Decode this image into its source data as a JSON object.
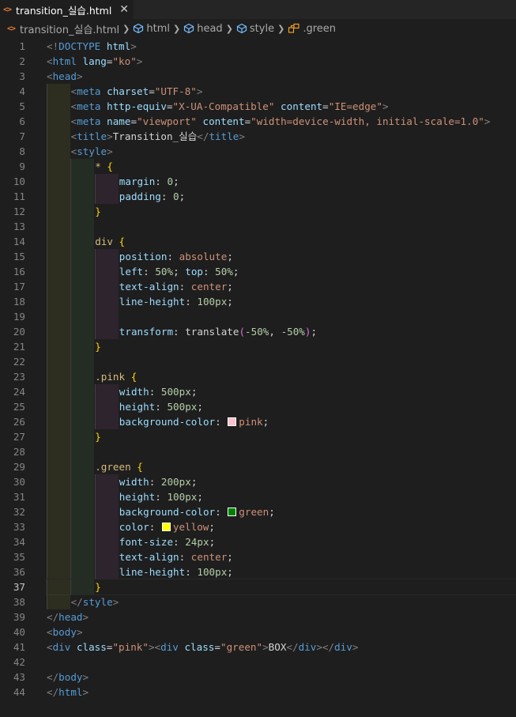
{
  "tab": {
    "title": "transition_실습.html",
    "icon": "html-file-icon",
    "close": "✕"
  },
  "breadcrumb": {
    "file": "transition_실습.html",
    "items": [
      "html",
      "head",
      "style",
      ".green"
    ]
  },
  "colors": {
    "pink": "#ffc0cb",
    "green": "#008000",
    "yellow": "#ffff00"
  },
  "lines": [
    {
      "n": "1",
      "indent": 0,
      "tokens": [
        [
          "bracket",
          "<!"
        ],
        [
          "tag",
          "DOCTYPE"
        ],
        [
          "text",
          " "
        ],
        [
          "attr",
          "html"
        ],
        [
          "bracket",
          ">"
        ]
      ]
    },
    {
      "n": "2",
      "indent": 0,
      "tokens": [
        [
          "bracket",
          "<"
        ],
        [
          "tag",
          "html"
        ],
        [
          "text",
          " "
        ],
        [
          "attr",
          "lang"
        ],
        [
          "text",
          "="
        ],
        [
          "str",
          "\"ko\""
        ],
        [
          "bracket",
          ">"
        ]
      ]
    },
    {
      "n": "3",
      "indent": 0,
      "tokens": [
        [
          "bracket",
          "<"
        ],
        [
          "tag",
          "head"
        ],
        [
          "bracket",
          ">"
        ]
      ]
    },
    {
      "n": "4",
      "indent": 1,
      "tokens": [
        [
          "bracket",
          "<"
        ],
        [
          "tag",
          "meta"
        ],
        [
          "text",
          " "
        ],
        [
          "attr",
          "charset"
        ],
        [
          "text",
          "="
        ],
        [
          "str",
          "\"UTF-8\""
        ],
        [
          "bracket",
          ">"
        ]
      ]
    },
    {
      "n": "5",
      "indent": 1,
      "tokens": [
        [
          "bracket",
          "<"
        ],
        [
          "tag",
          "meta"
        ],
        [
          "text",
          " "
        ],
        [
          "attr",
          "http-equiv"
        ],
        [
          "text",
          "="
        ],
        [
          "str",
          "\"X-UA-Compatible\""
        ],
        [
          "text",
          " "
        ],
        [
          "attr",
          "content"
        ],
        [
          "text",
          "="
        ],
        [
          "str",
          "\"IE=edge\""
        ],
        [
          "bracket",
          ">"
        ]
      ]
    },
    {
      "n": "6",
      "indent": 1,
      "tokens": [
        [
          "bracket",
          "<"
        ],
        [
          "tag",
          "meta"
        ],
        [
          "text",
          " "
        ],
        [
          "attr",
          "name"
        ],
        [
          "text",
          "="
        ],
        [
          "str",
          "\"viewport\""
        ],
        [
          "text",
          " "
        ],
        [
          "attr",
          "content"
        ],
        [
          "text",
          "="
        ],
        [
          "str",
          "\"width=device-width, initial-scale=1.0\""
        ],
        [
          "bracket",
          ">"
        ]
      ]
    },
    {
      "n": "7",
      "indent": 1,
      "tokens": [
        [
          "bracket",
          "<"
        ],
        [
          "tag",
          "title"
        ],
        [
          "bracket",
          ">"
        ],
        [
          "text",
          "Transition_실습"
        ],
        [
          "bracket",
          "</"
        ],
        [
          "tag",
          "title"
        ],
        [
          "bracket",
          ">"
        ]
      ]
    },
    {
      "n": "8",
      "indent": 1,
      "tokens": [
        [
          "bracket",
          "<"
        ],
        [
          "tag",
          "style"
        ],
        [
          "bracket",
          ">"
        ]
      ]
    },
    {
      "n": "9",
      "indent": 2,
      "tokens": [
        [
          "sel",
          "*"
        ],
        [
          "text",
          " "
        ],
        [
          "brace",
          "{"
        ]
      ]
    },
    {
      "n": "10",
      "indent": 3,
      "tokens": [
        [
          "attr",
          "margin"
        ],
        [
          "text",
          ": "
        ],
        [
          "num",
          "0"
        ],
        [
          "text",
          ";"
        ]
      ]
    },
    {
      "n": "11",
      "indent": 3,
      "tokens": [
        [
          "attr",
          "padding"
        ],
        [
          "text",
          ": "
        ],
        [
          "num",
          "0"
        ],
        [
          "text",
          ";"
        ]
      ]
    },
    {
      "n": "12",
      "indent": 2,
      "tokens": [
        [
          "brace",
          "}"
        ]
      ]
    },
    {
      "n": "13",
      "indent": 2,
      "tokens": []
    },
    {
      "n": "14",
      "indent": 2,
      "tokens": [
        [
          "sel",
          "div"
        ],
        [
          "text",
          " "
        ],
        [
          "brace",
          "{"
        ]
      ]
    },
    {
      "n": "15",
      "indent": 3,
      "tokens": [
        [
          "attr",
          "position"
        ],
        [
          "text",
          ": "
        ],
        [
          "val",
          "absolute"
        ],
        [
          "text",
          ";"
        ]
      ]
    },
    {
      "n": "16",
      "indent": 3,
      "tokens": [
        [
          "attr",
          "left"
        ],
        [
          "text",
          ": "
        ],
        [
          "num",
          "50%"
        ],
        [
          "text",
          "; "
        ],
        [
          "attr",
          "top"
        ],
        [
          "text",
          ": "
        ],
        [
          "num",
          "50%"
        ],
        [
          "text",
          ";"
        ]
      ]
    },
    {
      "n": "17",
      "indent": 3,
      "tokens": [
        [
          "attr",
          "text-align"
        ],
        [
          "text",
          ": "
        ],
        [
          "val",
          "center"
        ],
        [
          "text",
          ";"
        ]
      ]
    },
    {
      "n": "18",
      "indent": 3,
      "tokens": [
        [
          "attr",
          "line-height"
        ],
        [
          "text",
          ": "
        ],
        [
          "num",
          "100px"
        ],
        [
          "text",
          ";"
        ]
      ]
    },
    {
      "n": "19",
      "indent": 3,
      "tokens": []
    },
    {
      "n": "20",
      "indent": 3,
      "tokens": [
        [
          "attr",
          "transform"
        ],
        [
          "text",
          ": translate"
        ],
        [
          "paren",
          "("
        ],
        [
          "num",
          "-50%"
        ],
        [
          "text",
          ", "
        ],
        [
          "num",
          "-50%"
        ],
        [
          "paren",
          ")"
        ],
        [
          "text",
          ";"
        ]
      ]
    },
    {
      "n": "21",
      "indent": 2,
      "tokens": [
        [
          "brace",
          "}"
        ]
      ]
    },
    {
      "n": "22",
      "indent": 2,
      "tokens": []
    },
    {
      "n": "23",
      "indent": 2,
      "tokens": [
        [
          "sel",
          ".pink"
        ],
        [
          "text",
          " "
        ],
        [
          "brace",
          "{"
        ]
      ]
    },
    {
      "n": "24",
      "indent": 3,
      "tokens": [
        [
          "attr",
          "width"
        ],
        [
          "text",
          ": "
        ],
        [
          "num",
          "500px"
        ],
        [
          "text",
          ";"
        ]
      ]
    },
    {
      "n": "25",
      "indent": 3,
      "tokens": [
        [
          "attr",
          "height"
        ],
        [
          "text",
          ": "
        ],
        [
          "num",
          "500px"
        ],
        [
          "text",
          ";"
        ]
      ]
    },
    {
      "n": "26",
      "indent": 3,
      "tokens": [
        [
          "attr",
          "background-color"
        ],
        [
          "text",
          ": "
        ],
        [
          "swatch",
          "pink"
        ],
        [
          "val",
          "pink"
        ],
        [
          "text",
          ";"
        ]
      ]
    },
    {
      "n": "27",
      "indent": 2,
      "tokens": [
        [
          "brace",
          "}"
        ]
      ]
    },
    {
      "n": "28",
      "indent": 2,
      "tokens": []
    },
    {
      "n": "29",
      "indent": 2,
      "tokens": [
        [
          "sel",
          ".green"
        ],
        [
          "text",
          " "
        ],
        [
          "brace",
          "{"
        ]
      ]
    },
    {
      "n": "30",
      "indent": 3,
      "tokens": [
        [
          "attr",
          "width"
        ],
        [
          "text",
          ": "
        ],
        [
          "num",
          "200px"
        ],
        [
          "text",
          ";"
        ]
      ]
    },
    {
      "n": "31",
      "indent": 3,
      "tokens": [
        [
          "attr",
          "height"
        ],
        [
          "text",
          ": "
        ],
        [
          "num",
          "100px"
        ],
        [
          "text",
          ";"
        ]
      ]
    },
    {
      "n": "32",
      "indent": 3,
      "tokens": [
        [
          "attr",
          "background-color"
        ],
        [
          "text",
          ": "
        ],
        [
          "swatch",
          "green"
        ],
        [
          "val",
          "green"
        ],
        [
          "text",
          ";"
        ]
      ]
    },
    {
      "n": "33",
      "indent": 3,
      "tokens": [
        [
          "attr",
          "color"
        ],
        [
          "text",
          ": "
        ],
        [
          "swatch",
          "yellow"
        ],
        [
          "val",
          "yellow"
        ],
        [
          "text",
          ";"
        ]
      ]
    },
    {
      "n": "34",
      "indent": 3,
      "tokens": [
        [
          "attr",
          "font-size"
        ],
        [
          "text",
          ": "
        ],
        [
          "num",
          "24px"
        ],
        [
          "text",
          ";"
        ]
      ]
    },
    {
      "n": "35",
      "indent": 3,
      "tokens": [
        [
          "attr",
          "text-align"
        ],
        [
          "text",
          ": "
        ],
        [
          "val",
          "center"
        ],
        [
          "text",
          ";"
        ]
      ]
    },
    {
      "n": "36",
      "indent": 3,
      "tokens": [
        [
          "attr",
          "line-height"
        ],
        [
          "text",
          ": "
        ],
        [
          "num",
          "100px"
        ],
        [
          "text",
          ";"
        ]
      ]
    },
    {
      "n": "37",
      "indent": 2,
      "tokens": [
        [
          "brace",
          "}"
        ]
      ],
      "current": true
    },
    {
      "n": "38",
      "indent": 1,
      "tokens": [
        [
          "bracket",
          "</"
        ],
        [
          "tag",
          "style"
        ],
        [
          "bracket",
          ">"
        ]
      ]
    },
    {
      "n": "39",
      "indent": 0,
      "tokens": [
        [
          "bracket",
          "</"
        ],
        [
          "tag",
          "head"
        ],
        [
          "bracket",
          ">"
        ]
      ]
    },
    {
      "n": "40",
      "indent": 0,
      "tokens": [
        [
          "bracket",
          "<"
        ],
        [
          "tag",
          "body"
        ],
        [
          "bracket",
          ">"
        ]
      ]
    },
    {
      "n": "41",
      "indent": 0,
      "tokens": [
        [
          "bracket",
          "<"
        ],
        [
          "tag",
          "div"
        ],
        [
          "text",
          " "
        ],
        [
          "attr",
          "class"
        ],
        [
          "text",
          "="
        ],
        [
          "str",
          "\"pink\""
        ],
        [
          "bracket",
          "><"
        ],
        [
          "tag",
          "div"
        ],
        [
          "text",
          " "
        ],
        [
          "attr",
          "class"
        ],
        [
          "text",
          "="
        ],
        [
          "str",
          "\"green\""
        ],
        [
          "bracket",
          ">"
        ],
        [
          "text",
          "BOX"
        ],
        [
          "bracket",
          "</"
        ],
        [
          "tag",
          "div"
        ],
        [
          "bracket",
          "></"
        ],
        [
          "tag",
          "div"
        ],
        [
          "bracket",
          ">"
        ]
      ]
    },
    {
      "n": "42",
      "indent": 0,
      "tokens": []
    },
    {
      "n": "43",
      "indent": 0,
      "tokens": [
        [
          "bracket",
          "</"
        ],
        [
          "tag",
          "body"
        ],
        [
          "bracket",
          ">"
        ]
      ]
    },
    {
      "n": "44",
      "indent": 0,
      "tokens": [
        [
          "bracket",
          "</"
        ],
        [
          "tag",
          "html"
        ],
        [
          "bracket",
          ">"
        ]
      ]
    }
  ]
}
